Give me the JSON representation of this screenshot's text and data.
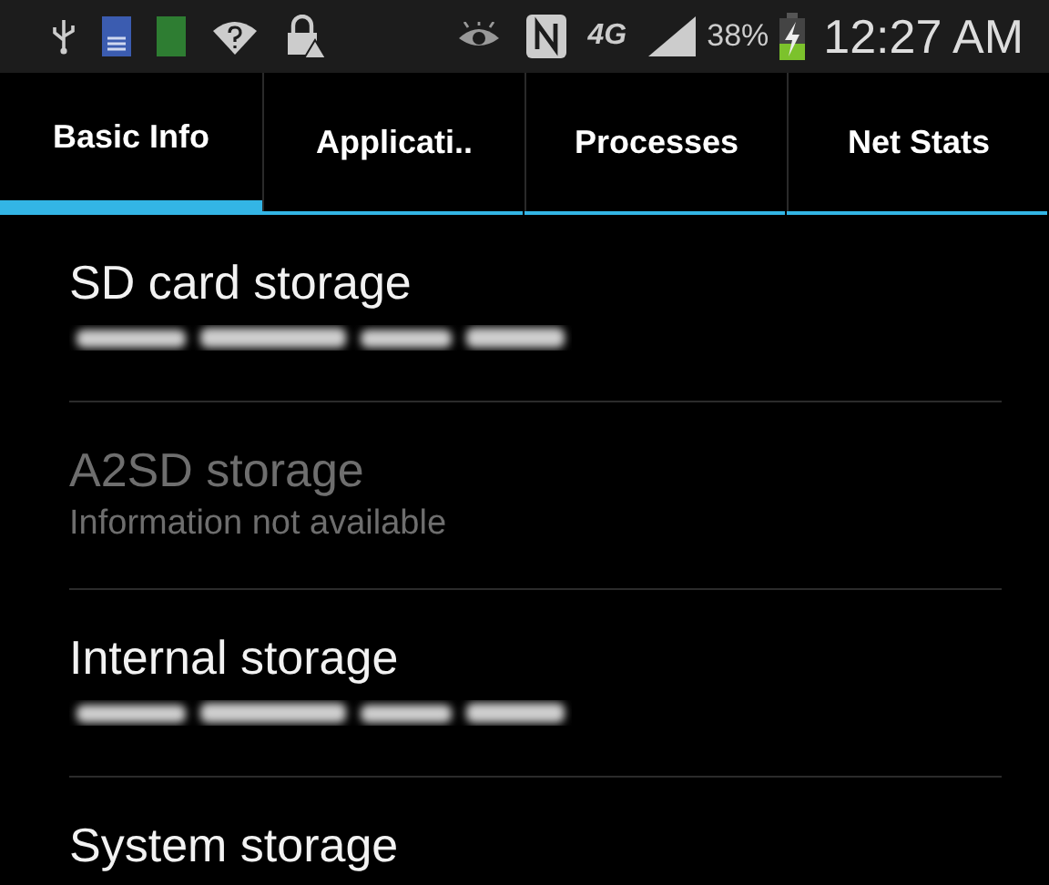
{
  "status_bar": {
    "network": "4G",
    "battery_text": "38%",
    "time": "12:27 AM"
  },
  "tabs": [
    {
      "label": "Basic Info",
      "selected": true
    },
    {
      "label": "Applicati..",
      "selected": false
    },
    {
      "label": "Processes",
      "selected": false
    },
    {
      "label": "Net Stats",
      "selected": false
    }
  ],
  "storage_items": [
    {
      "title": "SD card storage",
      "disabled": false,
      "detail": {
        "kind": "redacted"
      }
    },
    {
      "title": "A2SD storage",
      "disabled": true,
      "detail": {
        "kind": "text",
        "text": "Information not available"
      }
    },
    {
      "title": "Internal storage",
      "disabled": false,
      "detail": {
        "kind": "redacted"
      }
    },
    {
      "title": "System storage",
      "disabled": false
    }
  ]
}
